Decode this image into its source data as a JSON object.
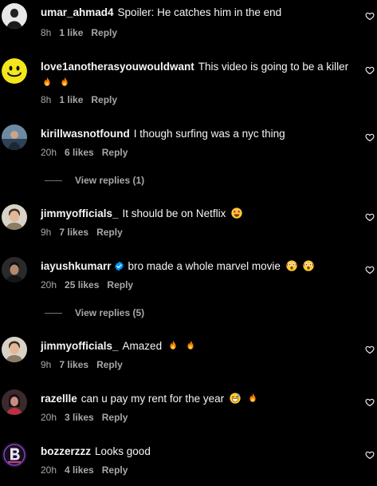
{
  "comments": [
    {
      "username": "umar_ahmad4",
      "text": "Spoiler: He catches him in the end",
      "time": "8h",
      "likes": "1 like",
      "reply_label": "Reply"
    },
    {
      "username": "love1anotherasyouwouldwant",
      "text": "This video is going to be a killer",
      "time": "8h",
      "likes": "1 like",
      "reply_label": "Reply"
    },
    {
      "username": "kirillwasnotfound",
      "text": "I though surfing was a nyc thing",
      "time": "20h",
      "likes": "6 likes",
      "reply_label": "Reply",
      "view_replies": "View replies (1)"
    },
    {
      "username": "jimmyofficials_",
      "text": "It should be on Netflix",
      "time": "9h",
      "likes": "7 likes",
      "reply_label": "Reply"
    },
    {
      "username": "iayushkumarr",
      "text": "bro made a whole marvel movie",
      "time": "20h",
      "likes": "25 likes",
      "reply_label": "Reply",
      "view_replies": "View replies (5)"
    },
    {
      "username": "jimmyofficials_",
      "text": "Amazed",
      "time": "9h",
      "likes": "7 likes",
      "reply_label": "Reply"
    },
    {
      "username": "razellle",
      "text": "can u pay my rent for the year",
      "time": "20h",
      "likes": "3 likes",
      "reply_label": "Reply"
    },
    {
      "username": "bozzerzzz",
      "text": "Looks good",
      "time": "20h",
      "likes": "4 likes",
      "reply_label": "Reply"
    }
  ],
  "icons": {
    "heart": "heart-outline-icon",
    "verified": "verified-badge-icon",
    "fire": "fire-emoji",
    "star_struck": "star-struck-emoji",
    "astonished": "astonished-emoji",
    "grinning_sweat": "grinning-sweat-emoji"
  },
  "colors": {
    "background": "#000000",
    "primary_text": "#f5f5f5",
    "secondary_text": "#a8a8a8",
    "verified_blue": "#0095f6"
  }
}
